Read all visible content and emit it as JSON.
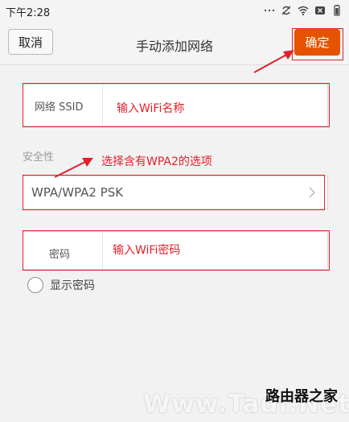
{
  "status_bar": {
    "time": "下午2:28"
  },
  "header": {
    "cancel_label": "取消",
    "title": "手动添加网络",
    "confirm_label": "确定",
    "confirm_color": "#e65300"
  },
  "form": {
    "ssid_label": "网络 SSID",
    "ssid_value": "",
    "security_label": "安全性",
    "security_value": "WPA/WPA2 PSK",
    "password_label": "密码",
    "password_value": "",
    "show_password_label": "显示密码",
    "show_password_checked": false
  },
  "annotations": {
    "ssid_hint": "输入WiFi名称",
    "security_hint": "选择含有WPA2的选项",
    "password_hint": "输入WiFi密码",
    "color": "#e0202a"
  },
  "watermark": {
    "text": "Www.Tadr.Net",
    "logo": "路由器之家"
  }
}
